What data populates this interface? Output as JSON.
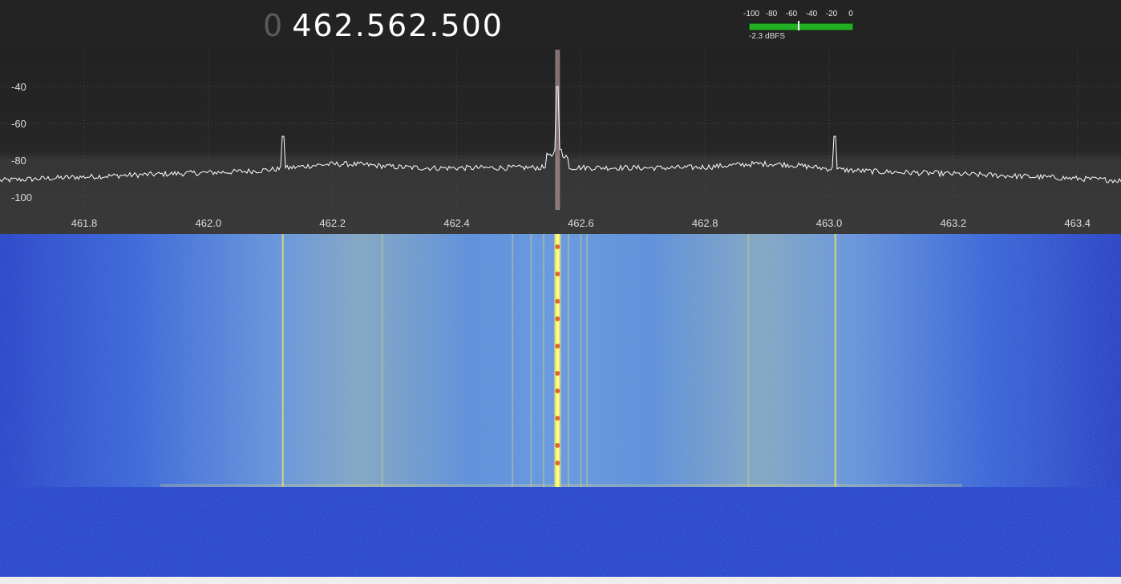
{
  "header": {
    "frequency_prefix": "0",
    "frequency_value": "462.562.500"
  },
  "level_meter": {
    "scale_labels": [
      "-100",
      "-80",
      "-60",
      "-40",
      "-20",
      "0"
    ],
    "readout": "-2.3 dBFS",
    "level_dbfs": -2.3
  },
  "spectrum": {
    "y_labels": [
      "-40",
      "-60",
      "-80",
      "-100"
    ],
    "x_labels": [
      "461.8",
      "462.0",
      "462.2",
      "462.4",
      "462.6",
      "462.8",
      "463.0",
      "463.2",
      "463.4"
    ],
    "tuned_frequency_mhz": 462.5625,
    "peaks_mhz": [
      462.12,
      462.5625,
      463.01
    ],
    "colors": {
      "background_top": "#222222",
      "background_bottom": "#383838",
      "trace": "#ffffff",
      "tuning_marker": "#d4b0b0"
    }
  },
  "waterfall": {
    "colors": {
      "low": "#2a46c8",
      "mid": "#5a8ce0",
      "high": "#e8e070",
      "peak": "#ffff80",
      "hot": "#d84020"
    }
  }
}
